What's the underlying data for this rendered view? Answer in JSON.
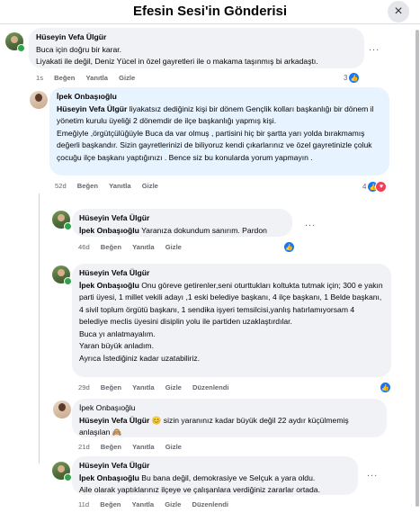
{
  "header": {
    "title": "Efesin Sesi'in Gönderisi",
    "close_icon": "×"
  },
  "comments": [
    {
      "author": "Hüseyin Vefa Ülgür",
      "text_lines": [
        "Buca için doğru bir karar.",
        "Liyakati ile değil, Deniz Yücel in özel gayretleri ile o makama taşınmış bi arkadaştı."
      ],
      "time": "1s",
      "like": "Beğen",
      "reply": "Yanıtla",
      "hide": "Gizle",
      "reaction_count": "3"
    },
    {
      "author": "İpek Onbaşıoğlu",
      "tag": "Hüseyin Vefa Ülgür",
      "text_first": " liyakatsız dediğiniz kişi bir dönem Gençlik kolları başkanlığı bir dönem il yönetim kurulu üyeliği 2 dönemdir de ilçe başkanlığı yapmış kişi.",
      "text_rest": "Emeğiyle ,örgütçülüğüyle Buca da var olmuş , partisini hiç bir şartta yarı yolda bırakmamış değerli başkandır. Sizin gayretlerinizi de biliyoruz kendi çıkarlarınız ve özel gayretinizle çoluk çocuğu ilçe başkanı yaptığınızı . Bence siz bu konularda yorum yapmayın .",
      "time": "52d",
      "like": "Beğen",
      "reply": "Yanıtla",
      "hide": "Gizle",
      "reaction_count": "4"
    },
    {
      "author": "Hüseyin Vefa Ülgür",
      "tag": "İpek Onbaşıoğlu",
      "text": " Yaranıza dokundum sanırım. Pardon",
      "time": "46d",
      "like": "Beğen",
      "reply": "Yanıtla",
      "hide": "Gizle"
    },
    {
      "author": "Hüseyin Vefa Ülgür",
      "tag": "İpek Onbaşıoğlu",
      "text_first": " Onu göreve getirenler,seni oturttukları koltukta tutmak için; 300 e yakın parti üyesi, 1 millet vekili adayı ,1 eski belediye başkanı, 4 ilçe başkanı, 1 Belde başkanı, 4 sivil toplum örgütü başkanı, 1 sendika işyeri temsilcisi,yanlış hatırlamıyorsam 4 belediye meclis üyesini disiplin yolu ile partiden uzaklaştırdılar.",
      "extra_lines": [
        "Buca yı anlatmayalım.",
        "Yaran büyük anladım.",
        "Ayrıca İstediğiniz kadar uzatabiliriz."
      ],
      "time": "29d",
      "like": "Beğen",
      "reply": "Yanıtla",
      "hide": "Gizle",
      "edited": "Düzenlendi"
    },
    {
      "author": "İpek Onbaşıoğlu",
      "tag": "Hüseyin Vefa Ülgür",
      "text": " sizin yaranınız kadar büyük değil 22 aydır küçülmemiş anlaşılan",
      "emoji_before": "😊",
      "emoji_after": "🙈",
      "time": "21d",
      "like": "Beğen",
      "reply": "Yanıtla",
      "hide": "Gizle"
    },
    {
      "author": "Hüseyin Vefa Ülgür",
      "tag": "İpek Onbaşıoğlu",
      "text_first": " Bu bana değil, demokrasiye ve Selçuk a yara oldu.",
      "text_rest": "Aile olarak yaptıklarınız ilçeye ve çalışanlara verdiğiniz zararlar ortada.",
      "time": "11d",
      "like": "Beğen",
      "reply": "Yanıtla",
      "hide": "Gizle",
      "edited": "Düzenlendi"
    }
  ],
  "more_label": "...",
  "colors": {
    "like": "#1877f2",
    "love": "#f33e58",
    "bubble": "#f0f2f5",
    "highlight": "#e7f3ff",
    "online": "#31a24c"
  },
  "icons": {
    "like": "like-icon",
    "love": "love-icon",
    "more": "more-options-icon",
    "close": "close-icon"
  }
}
